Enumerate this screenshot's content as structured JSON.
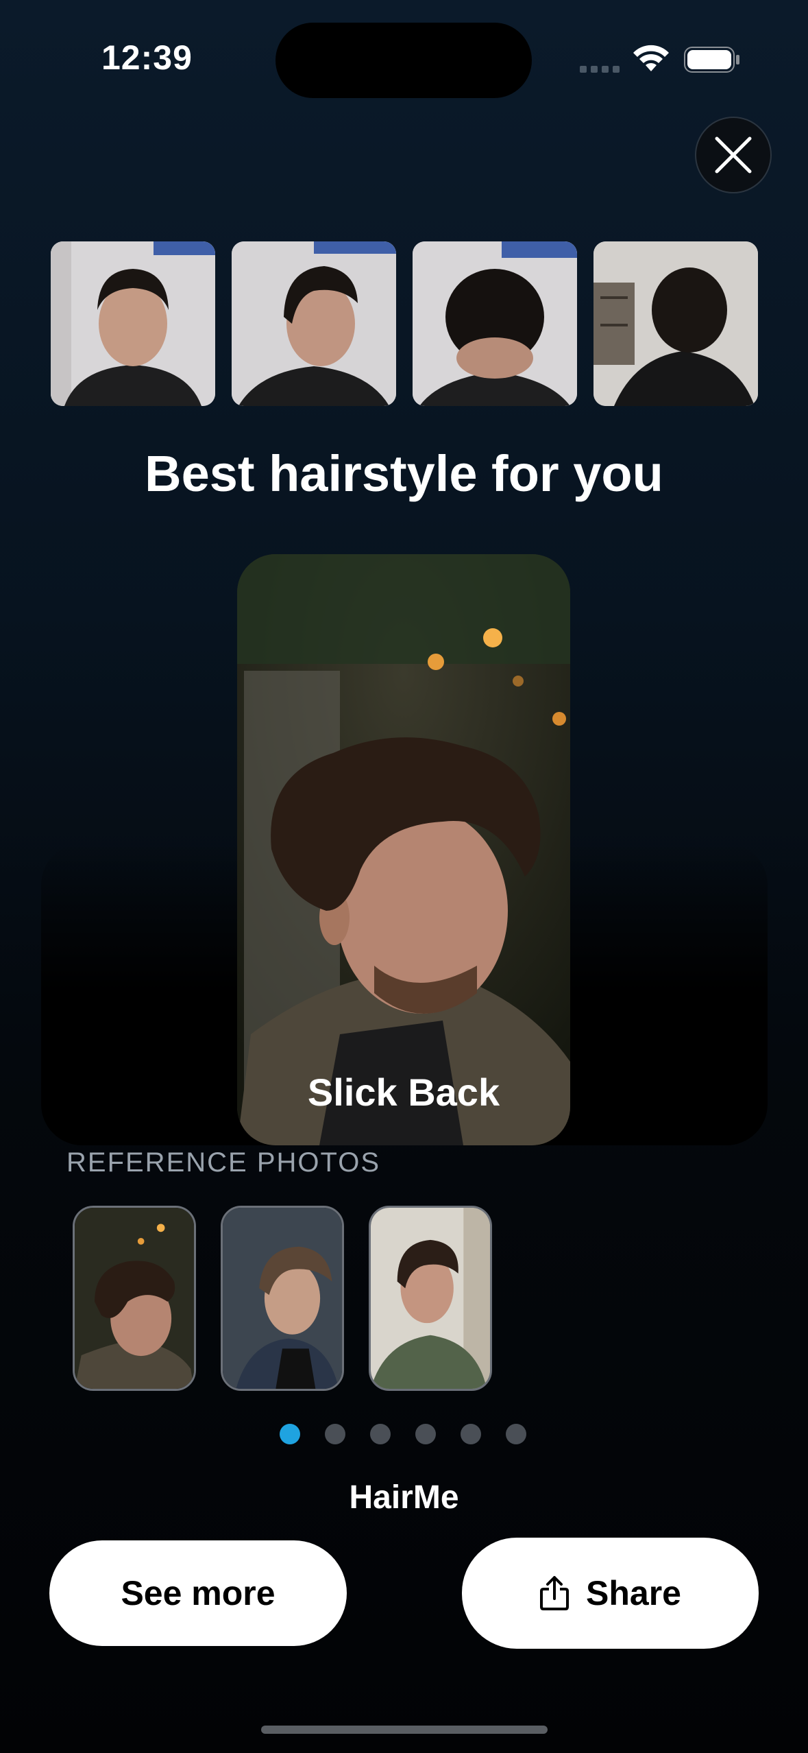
{
  "status_bar": {
    "time": "12:39"
  },
  "header": {
    "title": "Best hairstyle for you"
  },
  "selfies": [
    {
      "name": "front"
    },
    {
      "name": "side"
    },
    {
      "name": "top"
    },
    {
      "name": "back"
    }
  ],
  "result": {
    "style_name": "Slick Back"
  },
  "reference": {
    "label": "REFERENCE PHOTOS",
    "count": 3
  },
  "pagination": {
    "total": 6,
    "active": 1
  },
  "footer": {
    "brand": "HairMe",
    "see_more_label": "See more",
    "share_label": "Share"
  },
  "icons": [
    "close-icon",
    "share-icon",
    "wifi-icon",
    "battery-icon",
    "signal-icon"
  ],
  "colors": {
    "accent": "#1fa3e0",
    "button_bg": "#ffffff",
    "button_text": "#000000"
  }
}
